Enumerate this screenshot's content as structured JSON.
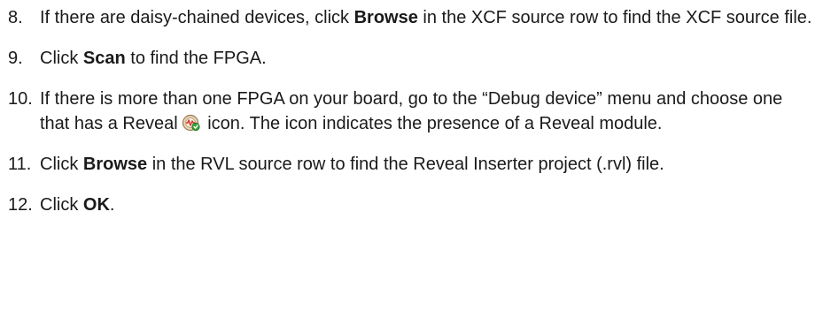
{
  "steps": [
    {
      "number": "8.",
      "t1": "If there are daisy-chained devices, click ",
      "b1": "Browse",
      "t2": " in the XCF source row to find the XCF source file."
    },
    {
      "number": "9.",
      "t1": "Click ",
      "b1": "Scan",
      "t2": " to find the FPGA."
    },
    {
      "number": "10.",
      "t1": "If there is more than one FPGA on your board, go to the “Debug device” menu and choose one that has a Reveal",
      "icon": "reveal-module-icon",
      "t2": " icon. The icon indicates the presence of a Reveal module."
    },
    {
      "number": "11.",
      "t1": "Click ",
      "b1": "Browse",
      "t2": " in the RVL source row to find the Reveal Inserter project (.rvl) file."
    },
    {
      "number": "12.",
      "t1": "Click ",
      "b1": "OK",
      "t2": "."
    }
  ]
}
